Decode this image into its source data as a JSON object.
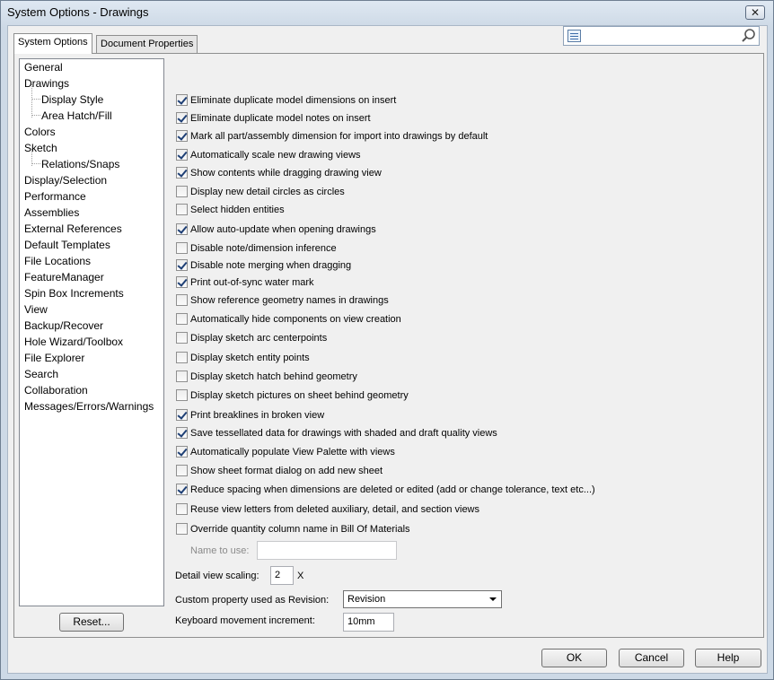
{
  "window": {
    "title": "System Options - Drawings"
  },
  "tabs": [
    {
      "label": "System Options",
      "active": true
    },
    {
      "label": "Document Properties",
      "active": false
    }
  ],
  "search": {
    "placeholder": ""
  },
  "tree": {
    "items": [
      {
        "label": "General",
        "level": 0
      },
      {
        "label": "Drawings",
        "level": 0,
        "selected": true
      },
      {
        "label": "Display Style",
        "level": 1
      },
      {
        "label": "Area Hatch/Fill",
        "level": 1
      },
      {
        "label": "Colors",
        "level": 0
      },
      {
        "label": "Sketch",
        "level": 0
      },
      {
        "label": "Relations/Snaps",
        "level": 1
      },
      {
        "label": "Display/Selection",
        "level": 0
      },
      {
        "label": "Performance",
        "level": 0
      },
      {
        "label": "Assemblies",
        "level": 0
      },
      {
        "label": "External References",
        "level": 0
      },
      {
        "label": "Default Templates",
        "level": 0
      },
      {
        "label": "File Locations",
        "level": 0
      },
      {
        "label": "FeatureManager",
        "level": 0
      },
      {
        "label": "Spin Box Increments",
        "level": 0
      },
      {
        "label": "View",
        "level": 0
      },
      {
        "label": "Backup/Recover",
        "level": 0
      },
      {
        "label": "Hole Wizard/Toolbox",
        "level": 0
      },
      {
        "label": "File Explorer",
        "level": 0
      },
      {
        "label": "Search",
        "level": 0
      },
      {
        "label": "Collaboration",
        "level": 0
      },
      {
        "label": "Messages/Errors/Warnings",
        "level": 0
      }
    ]
  },
  "options": [
    {
      "label": "Eliminate duplicate model dimensions on insert",
      "checked": true
    },
    {
      "label": "Eliminate duplicate model notes on insert",
      "checked": true
    },
    {
      "label": "Mark all part/assembly dimension for import into drawings by default",
      "checked": true
    },
    {
      "label": "Automatically scale new drawing views",
      "checked": true
    },
    {
      "label": "Show contents while dragging drawing view",
      "checked": true
    },
    {
      "label": "Display new detail circles as circles",
      "checked": false
    },
    {
      "label": "Select hidden entities",
      "checked": false
    },
    {
      "label": "Allow auto-update when opening drawings",
      "checked": true
    },
    {
      "label": "Disable note/dimension inference",
      "checked": false
    },
    {
      "label": "Disable note merging when dragging",
      "checked": true
    },
    {
      "label": "Print out-of-sync water mark",
      "checked": true
    },
    {
      "label": "Show reference geometry names in drawings",
      "checked": false
    },
    {
      "label": "Automatically hide components on view creation",
      "checked": false
    },
    {
      "label": "Display sketch arc centerpoints",
      "checked": false
    },
    {
      "label": "Display sketch entity points",
      "checked": false
    },
    {
      "label": "Display sketch hatch behind geometry",
      "checked": false
    },
    {
      "label": "Display sketch pictures on sheet behind geometry",
      "checked": false
    },
    {
      "label": "Print breaklines in broken view",
      "checked": true
    },
    {
      "label": "Save tessellated data for drawings with shaded and draft quality views",
      "checked": true
    },
    {
      "label": "Automatically populate View Palette with views",
      "checked": true
    },
    {
      "label": "Show sheet format dialog on add new sheet",
      "checked": false
    },
    {
      "label": "Reduce spacing when dimensions are deleted or edited (add or change tolerance, text etc...)",
      "checked": true
    },
    {
      "label": "Reuse view letters from deleted auxiliary, detail, and section views",
      "checked": false
    },
    {
      "label": "Override quantity column name in Bill Of Materials",
      "checked": false
    }
  ],
  "name_to_use": {
    "label": "Name to use:",
    "value": ""
  },
  "detail_scaling": {
    "label": "Detail view scaling:",
    "value": "2",
    "unit": "X"
  },
  "revision": {
    "label": "Custom property used as Revision:",
    "value": "Revision"
  },
  "keyboard": {
    "label": "Keyboard movement increment:",
    "value": "10mm"
  },
  "buttons": {
    "reset": "Reset...",
    "ok": "OK",
    "cancel": "Cancel",
    "help": "Help"
  }
}
